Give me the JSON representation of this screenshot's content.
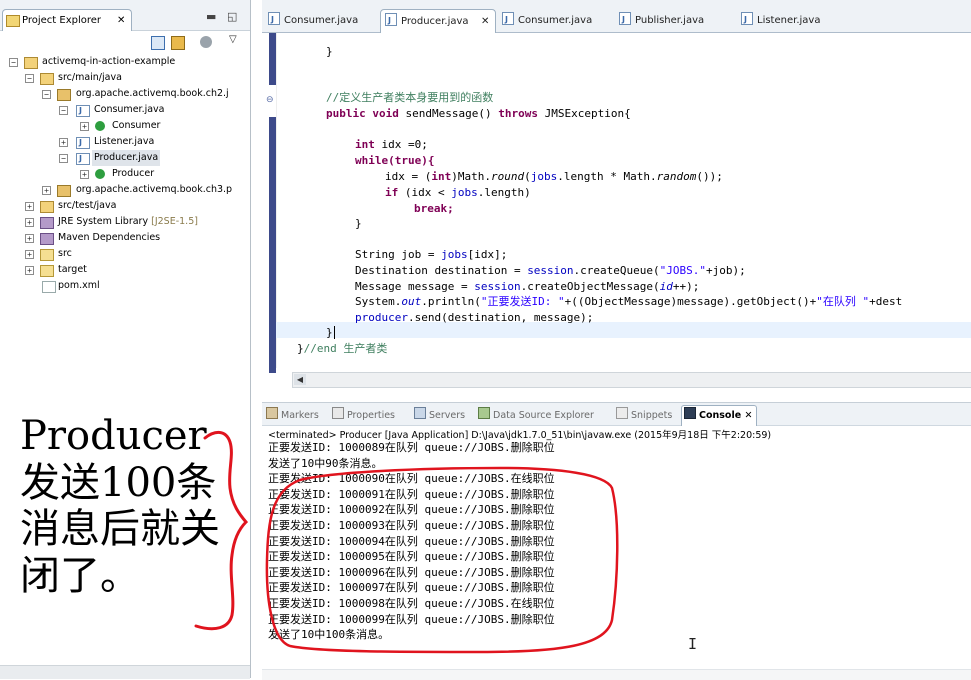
{
  "explorer": {
    "tab_label": "Project Explorer",
    "close_glyph": "✕",
    "tree": [
      {
        "label": "activemq-in-action-example",
        "icon": "project-icon"
      },
      {
        "label": "src/main/java",
        "icon": "source-folder-icon"
      },
      {
        "label": "org.apache.activemq.book.ch2.j",
        "icon": "package-icon"
      },
      {
        "label": "Consumer.java",
        "icon": "java-file-icon"
      },
      {
        "label": "Consumer",
        "icon": "class-icon"
      },
      {
        "label": "Listener.java",
        "icon": "java-file-icon"
      },
      {
        "label": "Producer.java",
        "icon": "java-file-icon"
      },
      {
        "label": "Producer",
        "icon": "class-icon"
      },
      {
        "label": "org.apache.activemq.book.ch3.p",
        "icon": "package-icon"
      },
      {
        "label": "src/test/java",
        "icon": "source-folder-icon"
      },
      {
        "label": "JRE System Library",
        "decoration": "[J2SE-1.5]",
        "icon": "library-icon"
      },
      {
        "label": "Maven Dependencies",
        "icon": "library-icon"
      },
      {
        "label": "src",
        "icon": "folder-icon"
      },
      {
        "label": "target",
        "icon": "folder-icon"
      },
      {
        "label": "pom.xml",
        "icon": "xml-file-icon"
      }
    ]
  },
  "editor": {
    "tabs": [
      "Consumer.java",
      "Producer.java",
      "Consumer.java",
      "Publisher.java",
      "Listener.java"
    ],
    "active_tab": "Producer.java",
    "code": {
      "l_close1": "}",
      "comment1": "//定义生产者类本身要用到的函数",
      "kw_public": "public",
      "kw_void": "void",
      "method_sig": "sendMessage()",
      "kw_throws": "throws",
      "exc": "JMSException{",
      "kw_int": "int",
      "idx_decl": "idx =0;",
      "kw_while": "while",
      "kw_true": "(true){",
      "idx_assign": "idx = (",
      "kw_int2": "int",
      "math_round": ")Math.",
      "round": "round",
      "jobs1": "(",
      "jobs_field1": "jobs",
      "len_mul": ".length * Math.",
      "random": "random",
      "random_end": "());",
      "kw_if": "if",
      "if_cond": "(idx < ",
      "jobs_field2": "jobs",
      "if_end": ".length)",
      "kw_break": "break;",
      "close2": "}",
      "string_job": "String job = ",
      "jobs_field3": "jobs",
      "idx_end": "[idx];",
      "dest_decl": "Destination destination = ",
      "session1": "session",
      "create_queue": ".createQueue(",
      "jobs_str": "\"JOBS.\"",
      "plus_job": "+job);",
      "msg_decl": "Message message = ",
      "session2": "session",
      "create_obj": ".createObjectMessage(",
      "id_field": "id",
      "id_end": "++);",
      "sys_out": "System.",
      "out": "out",
      "println": ".println(",
      "str_sending": "\"正要发送ID: \"",
      "println_mid": "+((ObjectMessage)message).getObject()+",
      "str_queue": "\"在队列 \"",
      "println_end": "+dest",
      "producer_field": "producer",
      "send_call": ".send(destination, message);",
      "close3": "}",
      "end_close": "}",
      "end_comment": "//end 生产者类"
    }
  },
  "console": {
    "tabs": [
      {
        "label": "Markers",
        "icon": "markers-icon"
      },
      {
        "label": "Properties",
        "icon": "properties-icon"
      },
      {
        "label": "Servers",
        "icon": "servers-icon"
      },
      {
        "label": "Data Source Explorer",
        "icon": "data-source-icon"
      },
      {
        "label": "Snippets",
        "icon": "snippets-icon"
      },
      {
        "label": "Console",
        "icon": "console-icon"
      }
    ],
    "status": "<terminated> Producer [Java Application] D:\\Java\\jdk1.7.0_51\\bin\\javaw.exe (2015年9月18日 下午2:20:59)",
    "lines": [
      "正要发送ID: 1000089在队列 queue://JOBS.删除职位",
      "发送了10中90条消息。",
      "正要发送ID: 1000090在队列 queue://JOBS.在线职位",
      "正要发送ID: 1000091在队列 queue://JOBS.删除职位",
      "正要发送ID: 1000092在队列 queue://JOBS.删除职位",
      "正要发送ID: 1000093在队列 queue://JOBS.删除职位",
      "正要发送ID: 1000094在队列 queue://JOBS.删除职位",
      "正要发送ID: 1000095在队列 queue://JOBS.删除职位",
      "正要发送ID: 1000096在队列 queue://JOBS.删除职位",
      "正要发送ID: 1000097在队列 queue://JOBS.删除职位",
      "正要发送ID: 1000098在队列 queue://JOBS.在线职位",
      "正要发送ID: 1000099在队列 queue://JOBS.删除职位",
      "发送了10中100条消息。"
    ]
  },
  "annotation": {
    "text": "Producer\n发送100条\n消息后就关\n闭了。",
    "color": "#e0141e"
  }
}
